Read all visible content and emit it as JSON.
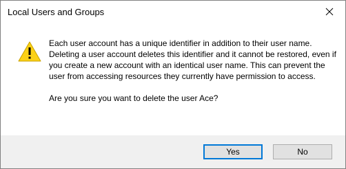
{
  "window": {
    "title": "Local Users and Groups"
  },
  "icons": {
    "warning": "warning-icon",
    "close": "close-icon"
  },
  "message": {
    "paragraph": "Each user account has a unique identifier in addition to their user name. Deleting a user account deletes this identifier and it cannot be restored, even if you create a new account with an identical user name. This can prevent the user from accessing resources they currently have permission to access.",
    "question": "Are you sure you want to delete the user Ace?"
  },
  "buttons": {
    "yes_label": "Yes",
    "no_label": "No"
  },
  "colors": {
    "warning_fill": "#fcd116",
    "default_button_border": "#0078d7",
    "footer_background": "#f0f0f0"
  }
}
